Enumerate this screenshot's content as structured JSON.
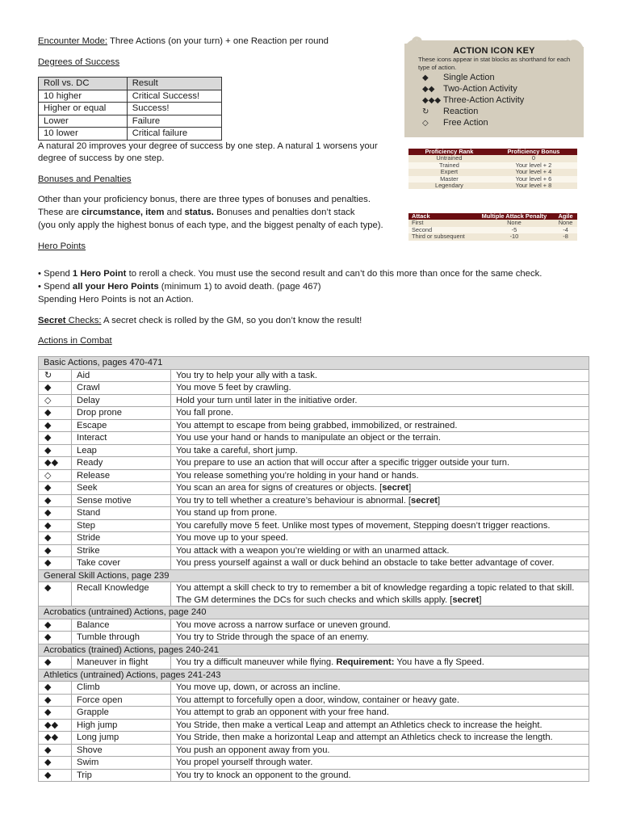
{
  "encounter": {
    "label": "Encounter Mode:",
    "text": " Three Actions (on your turn) + one Reaction per round"
  },
  "degrees": {
    "heading": "Degrees of Success",
    "columns": [
      "Roll vs. DC",
      "Result"
    ],
    "rows": [
      [
        "10 higher",
        "Critical Success!"
      ],
      [
        "Higher or equal",
        "Success!"
      ],
      [
        "Lower",
        "Failure"
      ],
      [
        "10 lower",
        "Critical failure"
      ]
    ],
    "note_line1": "A natural 20 improves your degree of success by one step. A natural 1 worsens your",
    "note_line2": "degree of success by one step."
  },
  "bonuses": {
    "heading": "Bonuses and Penalties",
    "line1": "Other than your proficiency bonus, there are three types of bonuses and penalties.",
    "line2_a": "These are ",
    "line2_b1": "circumstance, item",
    "line2_c": " and ",
    "line2_b2": "status.",
    "line2_d": " Bonuses and penalties don’t stack",
    "line3": "(you only apply the highest bonus of each type, and the biggest penalty of each type)."
  },
  "hero": {
    "heading": "Hero Points",
    "b1_a": "• Spend ",
    "b1_b": "1 Hero Point",
    "b1_c": " to reroll a check. You must use the second result and can’t do this more than once for the same check.",
    "b2_a": "• Spend ",
    "b2_b": "all your Hero Points",
    "b2_c": " (minimum 1) to avoid death. (page 467)",
    "note": "Spending Hero Points is not an Action."
  },
  "secret": {
    "bold": "Secret",
    "label": " Checks:",
    "text": " A secret check is rolled by the GM, so you don’t know the result!"
  },
  "combat_heading": "Actions in Combat",
  "icon_key": {
    "title": "ACTION ICON KEY",
    "desc": "These icons appear in stat blocks as shorthand for each type of action.",
    "items": [
      {
        "icon": "◆",
        "label": "Single Action"
      },
      {
        "icon": "◆◆",
        "label": "Two-Action Activity"
      },
      {
        "icon": "◆◆◆",
        "label": "Three-Action Activity"
      },
      {
        "icon": "↻",
        "label": "Reaction"
      },
      {
        "icon": "◇",
        "label": "Free Action"
      }
    ]
  },
  "proficiency": {
    "columns": [
      "Proficiency Rank",
      "Proficiency Bonus"
    ],
    "rows": [
      [
        "Untrained",
        "0"
      ],
      [
        "Trained",
        "Your level + 2"
      ],
      [
        "Expert",
        "Your level + 4"
      ],
      [
        "Master",
        "Your level + 6"
      ],
      [
        "Legendary",
        "Your level + 8"
      ]
    ]
  },
  "map": {
    "columns": [
      "Attack",
      "Multiple Attack Penalty",
      "Agile"
    ],
    "rows": [
      [
        "First",
        "None",
        "None"
      ],
      [
        "Second",
        "-5",
        "-4"
      ],
      [
        "Third or subsequent",
        "-10",
        "-8"
      ]
    ]
  },
  "actions": [
    {
      "section": "Basic Actions, pages 470-471"
    },
    {
      "icon": "↻",
      "name": "Aid",
      "desc": "You try to help your ally with a task."
    },
    {
      "icon": "◆",
      "name": "Crawl",
      "desc": "You move 5 feet by crawling."
    },
    {
      "icon": "◇",
      "name": "Delay",
      "desc": "Hold your turn until later in the initiative order."
    },
    {
      "icon": "◆",
      "name": "Drop prone",
      "desc": "You fall prone."
    },
    {
      "icon": "◆",
      "name": "Escape",
      "desc": "You attempt to escape from being grabbed, immobilized, or restrained."
    },
    {
      "icon": "◆",
      "name": "Interact",
      "desc": "You use your hand or hands to manipulate an object or the terrain."
    },
    {
      "icon": "◆",
      "name": "Leap",
      "desc": "You take a careful, short jump."
    },
    {
      "icon": "◆◆",
      "name": "Ready",
      "desc": "You prepare to use an action that will occur after a specific trigger outside your turn."
    },
    {
      "icon": "◇",
      "name": "Release",
      "desc": "You release something you’re holding in your hand or hands."
    },
    {
      "icon": "◆",
      "name": "Seek",
      "desc": "You scan an area for signs of creatures or objects. [",
      "bold": "secret",
      "tail": "]"
    },
    {
      "icon": "◆",
      "name": "Sense motive",
      "desc": "You try to tell whether a creature’s behaviour is abnormal. [",
      "bold": "secret",
      "tail": "]"
    },
    {
      "icon": "◆",
      "name": "Stand",
      "desc": "You stand up from prone."
    },
    {
      "icon": "◆",
      "name": "Step",
      "desc": "You carefully move 5 feet. Unlike most types of movement, Stepping doesn’t trigger reactions."
    },
    {
      "icon": "◆",
      "name": "Stride",
      "desc": "You move up to your speed."
    },
    {
      "icon": "◆",
      "name": "Strike",
      "desc": "You attack with a weapon you’re wielding or with an unarmed attack."
    },
    {
      "icon": "◆",
      "name": "Take cover",
      "desc": "You press yourself against a wall or duck behind an obstacle to take better advantage of cover."
    },
    {
      "section": "General Skill Actions, page 239"
    },
    {
      "icon": "◆",
      "name": "Recall Knowledge",
      "desc": "You attempt a skill check to try to remember a bit of knowledge regarding a topic related to that skill. The GM determines the DCs for such checks and which skills apply. [",
      "bold": "secret",
      "tail": "]"
    },
    {
      "section": "Acrobatics (untrained) Actions, page 240"
    },
    {
      "icon": "◆",
      "name": "Balance",
      "desc": "You move across a narrow surface or uneven ground."
    },
    {
      "icon": "◆",
      "name": "Tumble through",
      "desc": "You try to Stride through the space of an enemy."
    },
    {
      "section": "Acrobatics (trained) Actions, pages 240-241"
    },
    {
      "icon": "◆",
      "name": "Maneuver in flight",
      "desc": "You try a difficult maneuver while flying. ",
      "bold": "Requirement:",
      "tail": " You have a fly Speed."
    },
    {
      "section": "Athletics (untrained) Actions, pages 241-243"
    },
    {
      "icon": "◆",
      "name": "Climb",
      "desc": "You move up, down, or across an incline."
    },
    {
      "icon": "◆",
      "name": "Force open",
      "desc": "You attempt to forcefully open a door, window, container or heavy gate."
    },
    {
      "icon": "◆",
      "name": "Grapple",
      "desc": "You attempt to grab an opponent with your free hand."
    },
    {
      "icon": "◆◆",
      "name": "High jump",
      "desc": "You Stride, then make a vertical Leap and attempt an Athletics check to increase the height."
    },
    {
      "icon": "◆◆",
      "name": "Long jump",
      "desc": "You Stride, then make a horizontal Leap and attempt an Athletics check to increase the length."
    },
    {
      "icon": "◆",
      "name": "Shove",
      "desc": "You push an opponent away from you."
    },
    {
      "icon": "◆",
      "name": "Swim",
      "desc": "You propel yourself through water."
    },
    {
      "icon": "◆",
      "name": "Trip",
      "desc": "You try to knock an opponent to the ground."
    }
  ]
}
